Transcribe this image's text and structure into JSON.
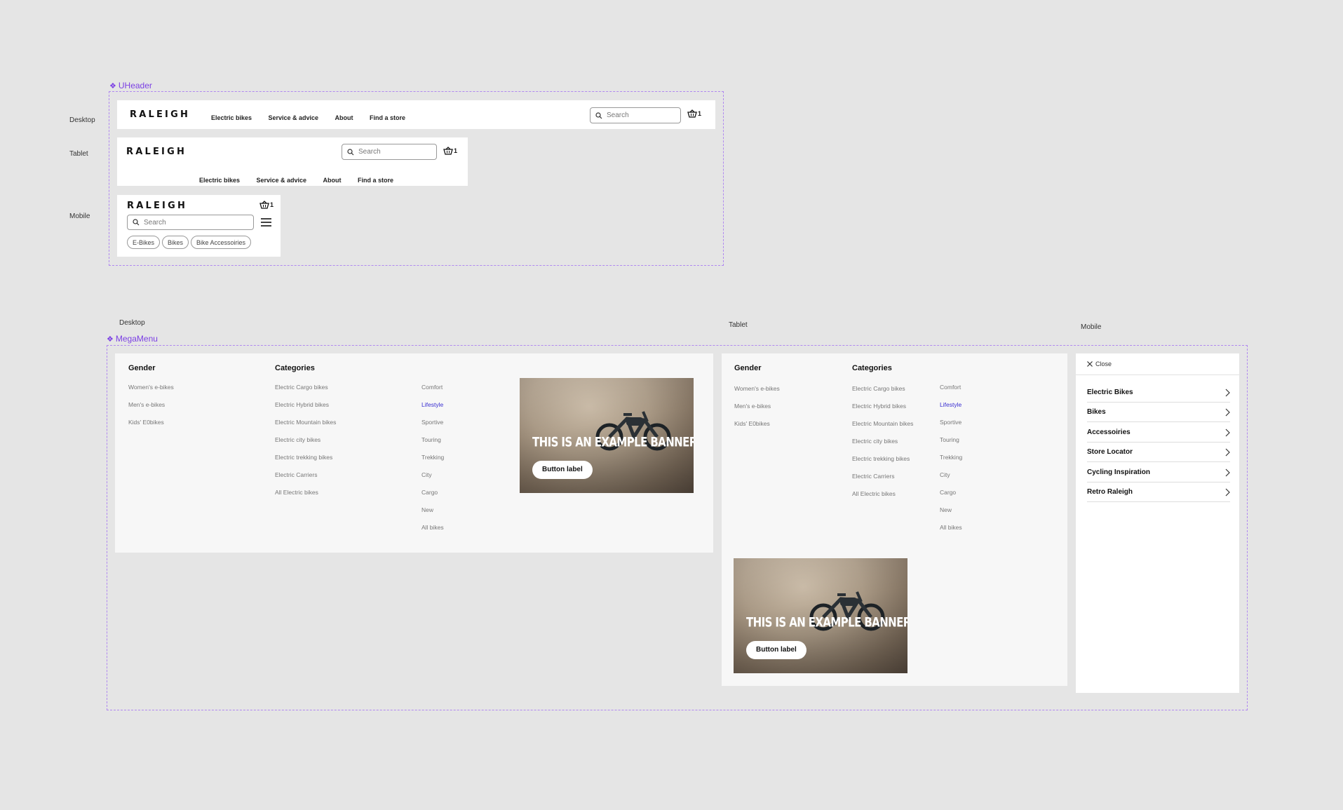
{
  "labels": {
    "uheader": "UHeader",
    "megamenu": "MegaMenu",
    "desktop": "Desktop",
    "tablet": "Tablet",
    "mobile": "Mobile"
  },
  "brand": "RALEIGH",
  "nav": [
    "Electric bikes",
    "Service & advice",
    "About",
    "Find a store"
  ],
  "search_placeholder": "Search",
  "basket_count": "1",
  "mobile_chips": [
    "E-Bikes",
    "Bikes",
    "Bike Accessoiries"
  ],
  "megamenu": {
    "gender_heading": "Gender",
    "categories_heading": "Categories",
    "gender": [
      "Women's e-bikes",
      "Men's e-bikes",
      "Kids' E0bikes"
    ],
    "categories": [
      "Electric Cargo bikes",
      "Electric Hybrid bikes",
      "Electric Mountain bikes",
      "Electric city bikes",
      "Electric trekking bikes",
      "Electric Carriers",
      "All Electric bikes"
    ],
    "types": [
      "Comfort",
      "Lifestyle",
      "Sportive",
      "Touring",
      "Trekking",
      "City",
      "Cargo",
      "New",
      "All bikes"
    ],
    "active_type": "Lifestyle",
    "banner_title": "THIS IS AN EXAMPLE BANNER",
    "banner_button": "Button label"
  },
  "mobile_menu": {
    "close_label": "Close",
    "items": [
      "Electric Bikes",
      "Bikes",
      "Accessoiries",
      "Store Locator",
      "Cycling Inspiration",
      "Retro Raleigh"
    ]
  },
  "colors": {
    "accent": "#7b3fe4",
    "active_link": "#3a2fd1"
  }
}
